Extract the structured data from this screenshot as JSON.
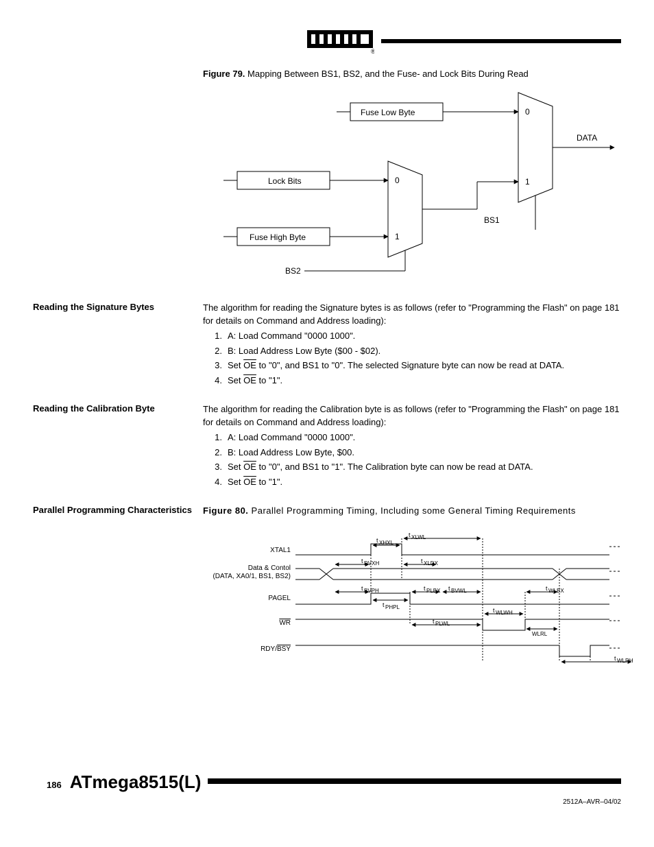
{
  "figure79": {
    "label": "Figure 79.",
    "caption": "Mapping Between BS1, BS2, and the Fuse- and Lock Bits During Read",
    "boxes": {
      "fuse_low": "Fuse Low Byte",
      "lock_bits": "Lock Bits",
      "fuse_high": "Fuse High Byte"
    },
    "labels": {
      "data": "DATA",
      "bs1": "BS1",
      "bs2": "BS2",
      "mux1_0": "0",
      "mux1_1": "1",
      "mux2_0": "0",
      "mux2_1": "1"
    }
  },
  "sig": {
    "heading": "Reading the Signature Bytes",
    "intro": "The algorithm for reading the Signature bytes is as follows (refer to \"Programming the Flash\" on page 181 for details on Command and Address loading):",
    "s1": "A: Load Command \"0000 1000\".",
    "s2": "B: Load Address Low Byte ($00 - $02).",
    "s3a": "Set ",
    "s3oe": "OE",
    "s3b": " to \"0\", and BS1 to \"0\". The selected Signature byte can now be read at DATA.",
    "s4a": "Set ",
    "s4oe": "OE",
    "s4b": " to \"1\"."
  },
  "cal": {
    "heading": "Reading the Calibration Byte",
    "intro": "The algorithm for reading the Calibration byte is as follows (refer to \"Programming the Flash\" on page 181 for details on Command and Address loading):",
    "s1": "A: Load Command \"0000 1000\".",
    "s2": "B: Load Address Low Byte, $00.",
    "s3a": "Set ",
    "s3oe": "OE",
    "s3b": " to \"0\", and BS1 to \"1\". The Calibration byte can now be read at DATA.",
    "s4a": "Set ",
    "s4oe": "OE",
    "s4b": " to \"1\"."
  },
  "pp": {
    "heading": "Parallel Programming Characteristics",
    "fig_label": "Figure 80.",
    "fig_caption": "Parallel Programming Timing, Including some General Timing Requirements",
    "signals": {
      "xtal1": "XTAL1",
      "datactrl_l1": "Data & Contol",
      "datactrl_l2": "(DATA, XA0/1, BS1, BS2)",
      "pagel": "PAGEL",
      "wr": "WR",
      "rdy_a": "RDY/",
      "rdy_b": "BSY"
    },
    "tlabels": {
      "xlwl": "XLWL",
      "xhxl": "XHXL",
      "dvxh": "DVXH",
      "xldx": "XLDX",
      "bvph": "BVPH",
      "plbx": "PLBX",
      "bvwl": "BVWL",
      "wlbx": "WLBX",
      "phpl": "PHPL",
      "wlwh": "WLWH",
      "plwl": "PLWL",
      "wlrl": "WLRL",
      "wlrh": "WLRH"
    }
  },
  "footer": {
    "page": "186",
    "product": "ATmega8515(L)",
    "docid": "2512A–AVR–04/02"
  }
}
